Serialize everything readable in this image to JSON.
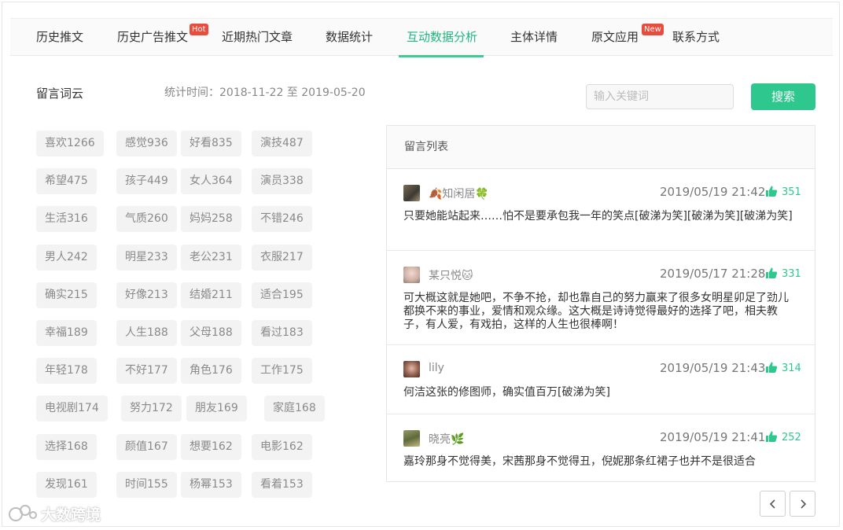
{
  "tabs": [
    {
      "label": "历史推文"
    },
    {
      "label": "历史广告推文",
      "badge": "Hot"
    },
    {
      "label": "近期热门文章"
    },
    {
      "label": "数据统计"
    },
    {
      "label": "互动数据分析",
      "active": true
    },
    {
      "label": "主体详情"
    },
    {
      "label": "原文应用",
      "badge": "New"
    },
    {
      "label": "联系方式"
    }
  ],
  "wordcloud": {
    "title": "留言词云",
    "stat_time": "统计时间：2018-11-22 至 2019-05-20",
    "tags": [
      "喜欢1266",
      "感觉936",
      "好看835",
      "演技487",
      "希望475",
      "孩子449",
      "女人364",
      "演员338",
      "生活316",
      "气质260",
      "妈妈258",
      "不错246",
      "男人242",
      "明星233",
      "老公231",
      "衣服217",
      "确实215",
      "好像213",
      "结婚211",
      "适合195",
      "幸福189",
      "人生188",
      "父母188",
      "看过183",
      "年轻178",
      "不好177",
      "角色176",
      "工作175",
      "电视剧174",
      "努力172",
      "朋友169",
      "家庭168",
      "选择168",
      "颜值167",
      "想要162",
      "电影162",
      "发现161",
      "时间155",
      "杨幂153",
      "看着153"
    ]
  },
  "search": {
    "placeholder": "输入关键词",
    "button": "搜索"
  },
  "comments": {
    "title": "留言列表",
    "items": [
      {
        "user": "🍂知闲居🍀",
        "time": "2019/05/19 21:42",
        "likes": "351",
        "text": "只要她能站起来……怕不是要承包我一年的笑点[破涕为笑][破涕为笑][破涕为笑]"
      },
      {
        "user": "某只悦🐱",
        "time": "2019/05/17 21:28",
        "likes": "331",
        "text": "可大概这就是她吧，不争不抢，却也靠自己的努力赢来了很多女明星卯足了劲儿都换不来的事业，爱情和观众缘。这大概是诗诗觉得最好的选择了吧，相夫教子，有人爱，有戏拍，这样的人生也很棒啊！"
      },
      {
        "user": "lily",
        "time": "2019/05/19 21:43",
        "likes": "314",
        "text": "何洁这张的修图师，确实值百万[破涕为笑]"
      },
      {
        "user": "晓亮🌿",
        "time": "2019/05/19 21:41",
        "likes": "252",
        "text": "嘉玲那身不觉得美，宋茜那身不觉得丑，倪妮那条红裙子也并不是很适合"
      }
    ]
  },
  "watermark": "大数跨境",
  "colors": {
    "accent": "#2ec88e",
    "badge": "#e74c3c",
    "tag_bg": "#f3f3f3"
  }
}
